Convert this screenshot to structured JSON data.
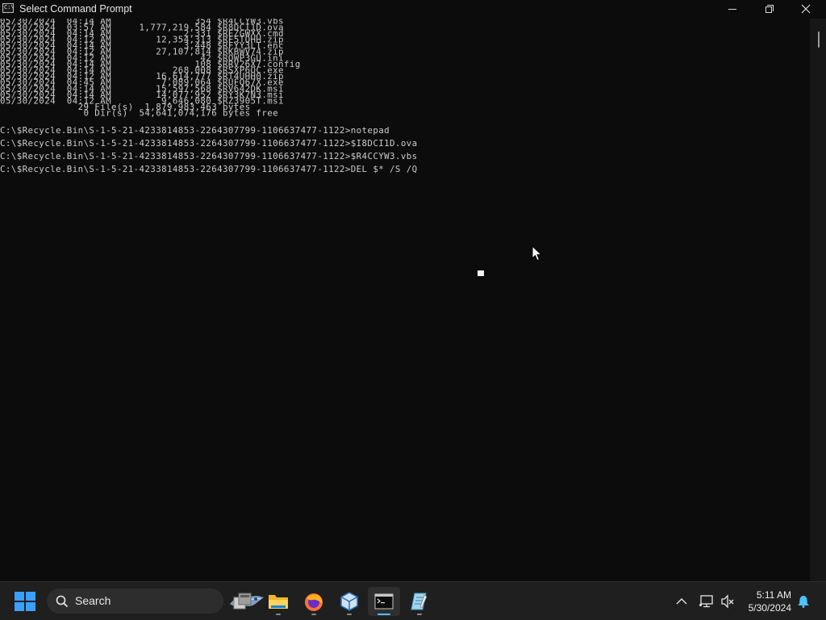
{
  "window": {
    "title": "Select Command Prompt",
    "icon_label": "C:\\",
    "controls": [
      "minimize",
      "maximize",
      "close"
    ]
  },
  "console": {
    "listing_lines": [
      "05/30/2024  04:14 AM               354 $R4CCYW3.vbs",
      "05/30/2024  03:57 AM     1,777,219,584 $R8DCI1D.ova",
      "05/30/2024  04:14 AM             2,331 $REZGWXX.cmd",
      "05/30/2024  04:12 AM        12,354,313 $RF5TQHH.zip",
      "05/30/2024  04:14 AM             3,448 $RFYY3LT.enc",
      "05/30/2024  04:12 AM        27,107,814 $RKBWV74.zip",
      "05/30/2024  04:12 AM                42 $RQWP3GU.ini",
      "05/30/2024  04:14 AM               108 $RRV26X7.config",
      "05/30/2024  04:14 AM           268,008 $RSXP6OC.exe",
      "05/30/2024  04:12 AM        16,614,777 $RT4UHH0.zip",
      "05/30/2024  04:45 AM         7,089,064 $RUFQ67X.exe",
      "05/30/2024  04:14 AM        15,597,568 $RV642DK.msi",
      "05/30/2024  04:14 AM        14,077,952 $RY3K7N3.msi",
      "05/30/2024  04:12 AM         9,646,080 $RZ3905T.msi",
      "              29 File(s)  1,879,983,463 bytes",
      "               0 Dir(s)  54,641,074,176 bytes free"
    ],
    "command_lines": [
      "C:\\$Recycle.Bin\\S-1-5-21-4233814853-2264307799-1106637477-1122>notepad",
      "C:\\$Recycle.Bin\\S-1-5-21-4233814853-2264307799-1106637477-1122>$I8DCI1D.ova",
      "C:\\$Recycle.Bin\\S-1-5-21-4233814853-2264307799-1106637477-1122>$R4CCYW3.vbs",
      "C:\\$Recycle.Bin\\S-1-5-21-4233814853-2264307799-1106637477-1122>DEL $* /S /Q"
    ]
  },
  "taskbar": {
    "search_label": "Search",
    "apps": [
      {
        "name": "task-view",
        "icon": "task-view-icon"
      },
      {
        "name": "file-explorer",
        "icon": "folder-icon"
      },
      {
        "name": "firefox",
        "icon": "firefox-icon"
      },
      {
        "name": "virtualbox",
        "icon": "virtualbox-icon"
      },
      {
        "name": "command-prompt",
        "icon": "terminal-icon",
        "active": true
      },
      {
        "name": "notepad",
        "icon": "notepad-icon"
      }
    ],
    "clock": {
      "time": "5:11 AM",
      "date": "5/30/2024"
    }
  },
  "colors": {
    "console_bg": "#0c0c0c",
    "console_text": "#cccccc",
    "taskbar_bg": "#1f1f1f",
    "accent": "#4cc2ff",
    "start_blue": "#3aa0ff"
  }
}
